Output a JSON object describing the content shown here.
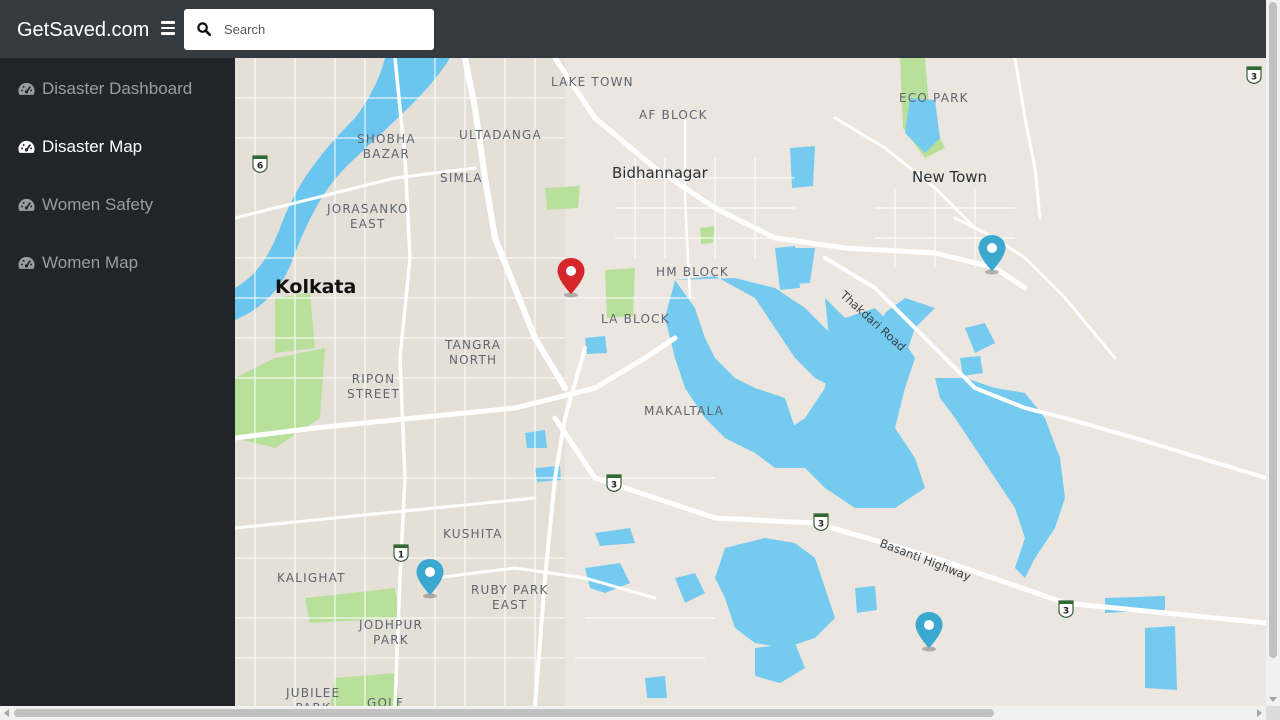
{
  "app": {
    "brand": "GetSaved.com",
    "menu_icon": "hamburger-icon"
  },
  "search": {
    "placeholder": "Search",
    "value": "",
    "icon": "search-icon"
  },
  "sidebar": {
    "items": [
      {
        "label": "Disaster Dashboard",
        "icon": "dashboard-icon",
        "active": false
      },
      {
        "label": "Disaster Map",
        "icon": "dashboard-icon",
        "active": true
      },
      {
        "label": "Women Safety",
        "icon": "dashboard-icon",
        "active": false
      },
      {
        "label": "Women Map",
        "icon": "dashboard-icon",
        "active": false
      }
    ]
  },
  "map": {
    "labels": {
      "lake_town": "LAKE TOWN",
      "af_block": "AF BLOCK",
      "eco_park": "ECO PARK",
      "shobha_bazar": "SHOBHA\nBAZAR",
      "ultadanga": "ULTADANGA",
      "bidhannagar": "Bidhannagar",
      "new_town": "New Town",
      "simla": "SIMLA",
      "jorasanko_east": "JORASANKO\nEAST",
      "hm_block": "HM BLOCK",
      "kolkata": "Kolkata",
      "la_block": "LA BLOCK",
      "thakdari_road": "Thakdari Road",
      "tangra_north": "TANGRA\nNORTH",
      "ripon_street": "RIPON\nSTREET",
      "makaltala": "MAKALTALA",
      "kushita": "KUSHITA",
      "basanti_highway": "Basanti Highway",
      "kalighat": "KALIGHAT",
      "ruby_park_east": "RUBY PARK\nEAST",
      "jodhpur_park": "JODHPUR\nPARK",
      "jubilee_park": "JUBILEE\nPARK",
      "golf": "GOLF"
    },
    "shields": {
      "s1": "6",
      "s2": "3",
      "s3": "3",
      "s4": "3",
      "s5": "3",
      "s6": "1"
    },
    "markers": [
      {
        "name": "red-location-marker",
        "color": "#d6262c"
      },
      {
        "name": "blue-location-marker",
        "color": "#3ba8cf"
      },
      {
        "name": "blue-location-marker",
        "color": "#3ba8cf"
      },
      {
        "name": "blue-location-marker",
        "color": "#3ba8cf"
      }
    ],
    "colors": {
      "land": "#ebe7e0",
      "water": "#74cbef",
      "park": "#b9e09a",
      "road": "#ffffff",
      "river": "#6ac6ee"
    }
  }
}
